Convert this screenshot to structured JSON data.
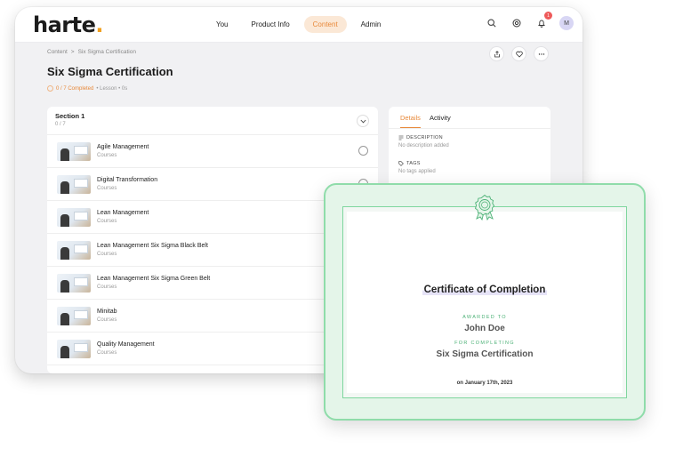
{
  "app": {
    "logo": "harte",
    "logo_dot": ".",
    "nav": [
      "You",
      "Product Info",
      "Content",
      "Admin"
    ],
    "notification_count": "1",
    "avatar_initial": "M",
    "accent_color": "#e8893a"
  },
  "breadcrumb": {
    "root": "Content",
    "separator": ">",
    "current": "Six Sigma Certification"
  },
  "page": {
    "title": "Six Sigma Certification",
    "progress": "0 / 7 Completed",
    "progress_meta": "• Lesson • 0s"
  },
  "section": {
    "title": "Section 1",
    "count": "0 / 7",
    "lessons": [
      {
        "title": "Agile Management",
        "type": "Courses"
      },
      {
        "title": "Digital Transformation",
        "type": "Courses"
      },
      {
        "title": "Lean Management",
        "type": "Courses"
      },
      {
        "title": "Lean Management Six Sigma Black Belt",
        "type": "Courses"
      },
      {
        "title": "Lean Management Six Sigma Green Belt",
        "type": "Courses"
      },
      {
        "title": "Minitab",
        "type": "Courses"
      },
      {
        "title": "Quality Management",
        "type": "Courses"
      }
    ]
  },
  "details": {
    "tabs": [
      "Details",
      "Activity"
    ],
    "description_label": "DESCRIPTION",
    "description_value": "No description added",
    "tags_label": "TAGS",
    "tags_value": "No tags applied"
  },
  "certificate": {
    "title": "Certificate of Completion",
    "awarded_label": "AWARDED TO",
    "recipient": "John Doe",
    "for_label": "FOR COMPLETING",
    "course": "Six Sigma Certification",
    "date": "on January 17th, 2023",
    "border_color": "#8fdcaa"
  }
}
